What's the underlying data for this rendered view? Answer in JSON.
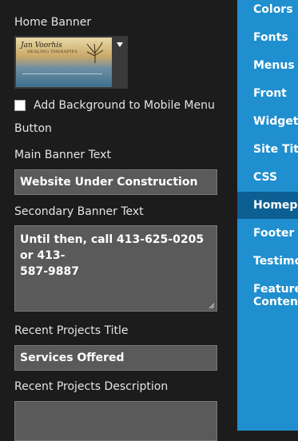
{
  "left": {
    "home_banner_label": "Home Banner",
    "banner_image": {
      "logo_text": "Jan Voorhis",
      "logo_subtext": "HEALING THERAPIES"
    },
    "mobile_checkbox_label_line1": "Add Background to Mobile Menu",
    "mobile_checkbox_label_line2": "Button",
    "mobile_checkbox_checked": false,
    "main_banner_label": "Main Banner Text",
    "main_banner_value": "Website Under Construction",
    "secondary_banner_label": "Secondary Banner Text",
    "secondary_banner_line1": "Until then, call 413-625-0205 or 413-",
    "secondary_banner_line2": "587-9887",
    "recent_projects_title_label": "Recent Projects Title",
    "recent_projects_title_value": "Services Offered",
    "recent_projects_desc_label": "Recent Projects Description",
    "recent_projects_desc_value": ""
  },
  "nav": {
    "items": [
      {
        "label": "Colors"
      },
      {
        "label": "Fonts"
      },
      {
        "label": "Menus"
      },
      {
        "label": "Front"
      },
      {
        "label": "Widgets"
      },
      {
        "label": "Site Title"
      },
      {
        "label": "CSS"
      },
      {
        "label": "Homep..."
      },
      {
        "label": "Footer"
      },
      {
        "label": "Testimo..."
      },
      {
        "label": "Featured"
      },
      {
        "label": "Content"
      }
    ],
    "active_index": 7,
    "bg_color": "#1f8fcf",
    "active_color": "#0c5f93"
  }
}
